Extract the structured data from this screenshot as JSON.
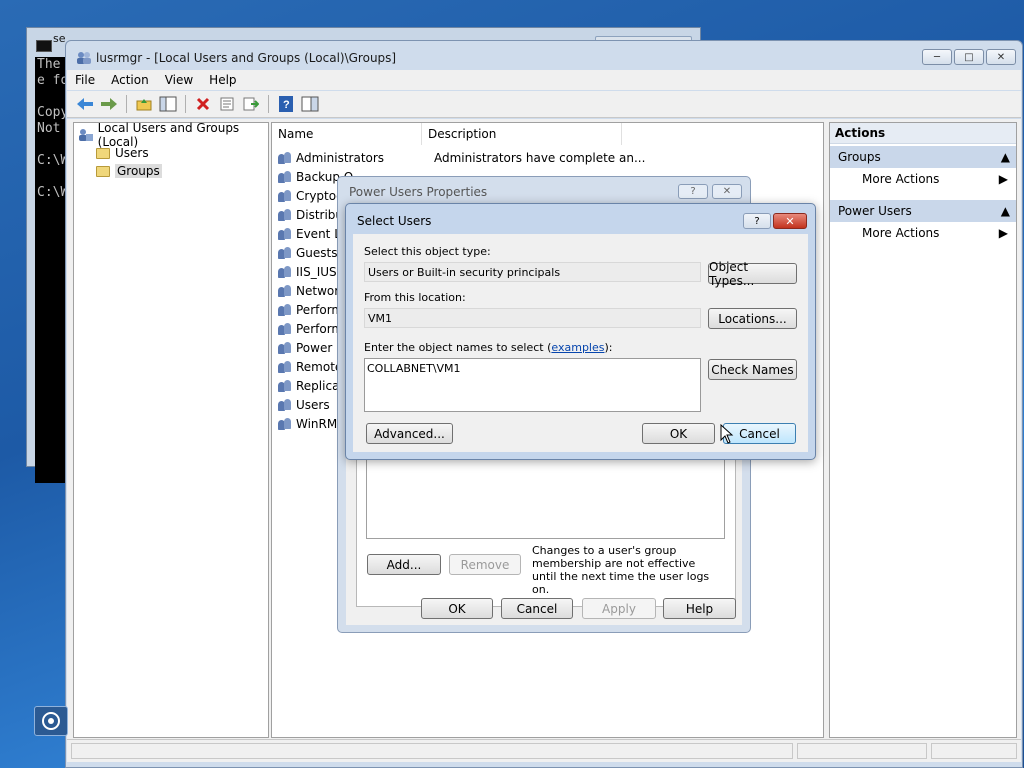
{
  "console": {
    "title": "se",
    "lines": [
      "The",
      "e fo",
      "",
      "Copy",
      "Not",
      "",
      "C:\\W",
      "",
      "C:\\W"
    ]
  },
  "main_window": {
    "title": "lusrmgr - [Local Users and Groups (Local)\\Groups]",
    "menu": [
      "File",
      "Action",
      "View",
      "Help"
    ],
    "tree": {
      "root": "Local Users and Groups (Local)",
      "children": [
        "Users",
        "Groups"
      ],
      "selected": "Groups"
    },
    "columns": [
      "Name",
      "Description"
    ],
    "rows": [
      {
        "name": "Administrators",
        "description": "Administrators have complete an..."
      },
      {
        "name": "Backup O",
        "description": ""
      },
      {
        "name": "Cryptog",
        "description": ""
      },
      {
        "name": "Distribut",
        "description": ""
      },
      {
        "name": "Event Lo",
        "description": ""
      },
      {
        "name": "Guests",
        "description": ""
      },
      {
        "name": "IIS_IUSR",
        "description": ""
      },
      {
        "name": "Network",
        "description": ""
      },
      {
        "name": "Perform",
        "description": ""
      },
      {
        "name": "Perform",
        "description": ""
      },
      {
        "name": "Power U",
        "description": ""
      },
      {
        "name": "Remote",
        "description": ""
      },
      {
        "name": "Replicat",
        "description": ""
      },
      {
        "name": "Users",
        "description": ""
      },
      {
        "name": "WinRM",
        "description": ""
      }
    ],
    "actions": {
      "header": "Actions",
      "sections": [
        {
          "title": "Groups",
          "items": [
            "More Actions"
          ]
        },
        {
          "title": "Power Users",
          "items": [
            "More Actions"
          ]
        }
      ]
    }
  },
  "props_dialog": {
    "title": "Power Users Properties",
    "note": "Changes to a user's group membership are not effective until the next time the user logs on.",
    "buttons": {
      "add": "Add...",
      "remove": "Remove",
      "ok": "OK",
      "cancel": "Cancel",
      "apply": "Apply",
      "help": "Help"
    }
  },
  "select_dialog": {
    "title": "Select Users",
    "object_type_label": "Select this object type:",
    "object_type_value": "Users or Built-in security principals",
    "object_types_button": "Object Types...",
    "location_label": "From this location:",
    "location_value": "VM1",
    "locations_button": "Locations...",
    "names_label_prefix": "Enter the object names to select (",
    "names_label_link": "examples",
    "names_label_suffix": "):",
    "names_value": "COLLABNET\\VM1",
    "check_names_button": "Check Names",
    "advanced_button": "Advanced...",
    "ok_button": "OK",
    "cancel_button": "Cancel"
  },
  "colors": {
    "desktop": "#1d5aa6",
    "window_frame": "#cfdcec",
    "close_red": "#c2321d",
    "link": "#0645ad"
  }
}
